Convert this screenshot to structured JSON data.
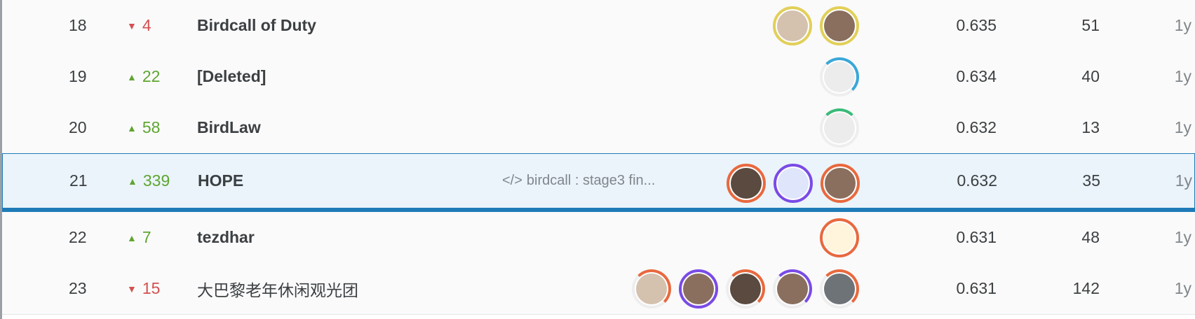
{
  "rows": [
    {
      "rank": "18",
      "direction": "down",
      "change": "4",
      "team": "Birdcall of Duty",
      "code": "",
      "score": "0.635",
      "entries": "51",
      "last": "1y",
      "avatars": [
        {
          "icon": "person-photo-icon",
          "ring": "ring-gold",
          "bg": "photo-light"
        },
        {
          "icon": "person-photo-icon",
          "ring": "ring-gold",
          "bg": "photo-mid"
        }
      ]
    },
    {
      "rank": "19",
      "direction": "up",
      "change": "22",
      "team": "[Deleted]",
      "code": "",
      "score": "0.634",
      "entries": "40",
      "last": "1y",
      "avatars": [
        {
          "icon": "goose-icon",
          "ring": "ring-blue-partial",
          "bg": "goose"
        }
      ]
    },
    {
      "rank": "20",
      "direction": "up",
      "change": "58",
      "team": "BirdLaw",
      "code": "",
      "score": "0.632",
      "entries": "13",
      "last": "1y",
      "avatars": [
        {
          "icon": "goose-icon",
          "ring": "ring-green-partial",
          "bg": "goose"
        }
      ]
    },
    {
      "rank": "21",
      "direction": "up",
      "change": "339",
      "team": "HOPE",
      "code": "birdcall : stage3 fin...",
      "score": "0.632",
      "entries": "35",
      "last": "1y",
      "highlight": true,
      "avatars": [
        {
          "icon": "person-photo-icon",
          "ring": "ring-orange",
          "bg": "photo-dark"
        },
        {
          "icon": "brain-chip-icon",
          "ring": "ring-purple",
          "bg": "chip"
        },
        {
          "icon": "person-photo-icon",
          "ring": "ring-orange",
          "bg": "photo-mid"
        }
      ]
    },
    {
      "rank": "22",
      "direction": "up",
      "change": "7",
      "team": "tezdhar",
      "code": "",
      "score": "0.631",
      "entries": "48",
      "last": "1y",
      "avatars": [
        {
          "icon": "skull-hat-icon",
          "ring": "ring-orange",
          "bg": "skull"
        }
      ]
    },
    {
      "rank": "23",
      "direction": "down",
      "change": "15",
      "team": "大巴黎老年休闲观光团",
      "code": "",
      "score": "0.631",
      "entries": "142",
      "last": "1y",
      "avatars": [
        {
          "icon": "person-photo-icon",
          "ring": "ring-orange-partial",
          "bg": "photo-light"
        },
        {
          "icon": "person-photo-icon",
          "ring": "ring-purple",
          "bg": "photo-mid"
        },
        {
          "icon": "person-photo-icon",
          "ring": "ring-orange-partial",
          "bg": "photo-dark"
        },
        {
          "icon": "person-photo-icon",
          "ring": "ring-purple-partial",
          "bg": "photo-mid"
        },
        {
          "icon": "statue-icon",
          "ring": "ring-orange-partial",
          "bg": "photo-gray"
        }
      ]
    }
  ],
  "icons": {
    "up_arrow": "▲",
    "down_arrow": "▼",
    "code_glyph": "</>"
  },
  "colors": {
    "up": "#5fa531",
    "down": "#d35151",
    "highlight_border": "#1f7bb8"
  }
}
